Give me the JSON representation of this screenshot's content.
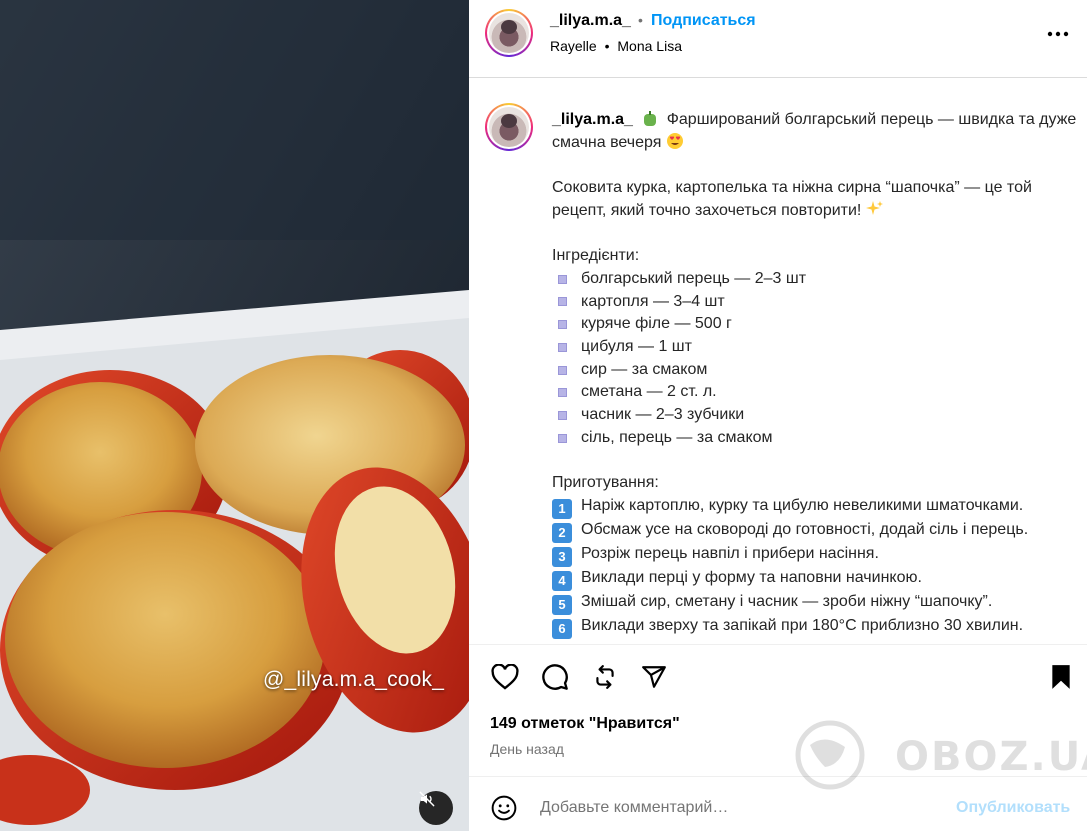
{
  "media": {
    "watermark": "@_lilya.m.a_cook_",
    "mute_icon": "mute-icon"
  },
  "header": {
    "username": "_lilya.m.a_",
    "dot": "•",
    "follow_label": "Подписаться",
    "audio_artist": "Rayelle",
    "audio_dot": "•",
    "audio_title": "Mona Lisa",
    "more_icon": "more-horizontal-icon"
  },
  "caption": {
    "username": "_lilya.m.a_",
    "title": "Фарширований болгарський перець — швидка та дуже смачна вечеря",
    "intro": "Соковита курка, картопелька та ніжна сирна “шапочка” — це той рецепт, який точно захочеться повторити!",
    "ingredients_heading": "Інгредієнти:",
    "ingredients": [
      "болгарський перець — 2–3 шт",
      "картопля — 3–4 шт",
      "куряче філе — 500 г",
      "цибуля — 1 шт",
      "сир — за смаком",
      "сметана — 2 ст. л.",
      "часник — 2–3 зубчики",
      "сіль, перець — за смаком"
    ],
    "steps_heading": "Приготування:",
    "steps": [
      {
        "num": "1",
        "text": "Наріж картоплю, курку та цибулю невеликими шматочками."
      },
      {
        "num": "2",
        "text": "Обсмаж усе на сковороді до готовності, додай сіль і перець."
      },
      {
        "num": "3",
        "text": "Розріж перець навпіл і прибери насіння."
      },
      {
        "num": "4",
        "text": "Виклади перці у форму та наповни начинкою."
      },
      {
        "num": "5",
        "text": "Змішай сир, сметану і часник — зроби ніжну “шапочку”."
      },
      {
        "num": "6",
        "text": "Виклади зверху та запікай при 180°C приблизно 30 хвилин."
      }
    ]
  },
  "actions": {
    "icons": [
      "heart-icon",
      "comment-icon",
      "repost-icon",
      "share-icon",
      "bookmark-icon"
    ],
    "likes_text": "149 отметок \"Нравится\"",
    "time_text": "День назад"
  },
  "comment": {
    "placeholder": "Добавьте комментарий…",
    "post_label": "Опубликовать"
  },
  "overlay": {
    "site_watermark": "OBOZ.UA"
  },
  "colors": {
    "accent": "#0095f6",
    "post_disabled": "#b2dffc",
    "muted": "#737373"
  }
}
